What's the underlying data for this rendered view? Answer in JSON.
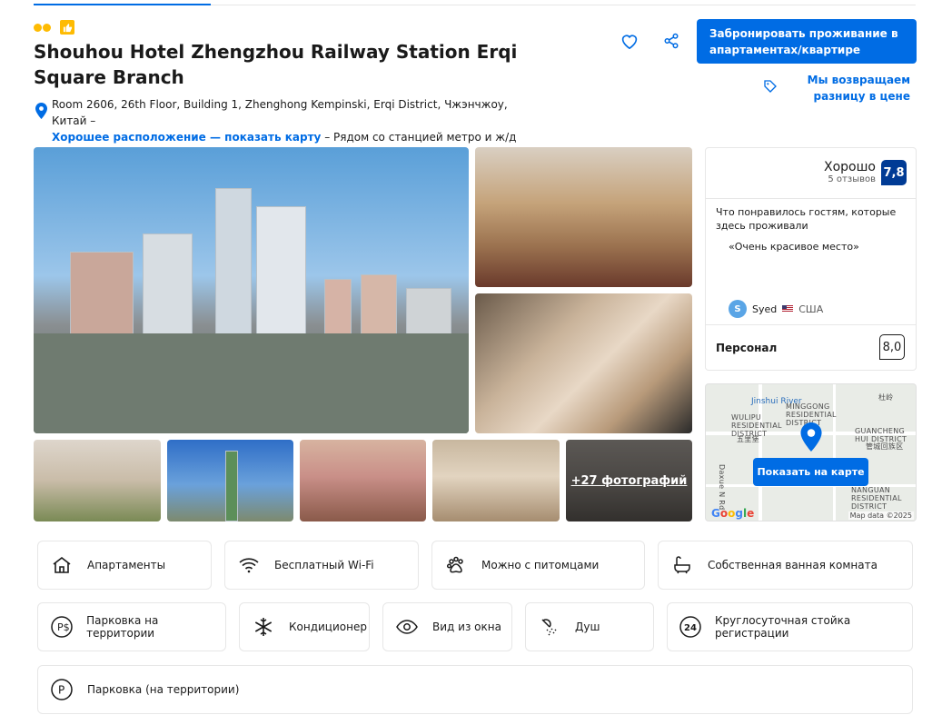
{
  "header": {
    "title": "Shouhou Hotel Zhengzhou Railway Station Erqi Square Branch",
    "address": "Room 2606, 26th Floor, Building 1, Zhenghong Kempinski, Erqi District, Чжэнчжоу, Китай –",
    "location_link": "Хорошее расположение — показать карту",
    "location_note": "– Рядом со станцией метро и ж/д",
    "book_button": "Забронировать проживание в апартаментах/квартире",
    "price_match": "Мы возвращаем разницу в цене",
    "icons": [
      "heart-icon",
      "share-icon",
      "price-tag-icon"
    ]
  },
  "gallery": {
    "more_photos": "+27 фотографий"
  },
  "reviews": {
    "rating_word": "Хорошо",
    "review_count": "5 отзывов",
    "score": "7,8",
    "liked_heading": "Что понравилось гостям, которые здесь проживали",
    "quote": "«Очень красивое место»",
    "author_initial": "S",
    "author_name": "Syed",
    "author_country": "США",
    "staff_label": "Персонал",
    "staff_score": "8,0"
  },
  "map": {
    "button": "Показать на карте",
    "river": "Jinshui River",
    "labels": {
      "wulipu": "WULIPU\nRESIDENTIAL\nDISTRICT",
      "wulipu_cn": "五里堡",
      "minggong": "MINGGONG\nRESIDENTIAL\nDISTRICT",
      "guancheng": "GUANCHENG\nHUI DISTRICT",
      "guancheng_cn": "管城回族区",
      "nanguan": "NANGUAN\nRESIDENTIAL\nDISTRICT",
      "daxue": "Daxue N Rd",
      "duling": "杜岭"
    },
    "google": "Google",
    "map_data": "Map data ©2025"
  },
  "facilities": [
    {
      "label": "Апартаменты",
      "icon": "apartment-icon"
    },
    {
      "label": "Бесплатный Wi-Fi",
      "icon": "wifi-icon"
    },
    {
      "label": "Можно с питомцами",
      "icon": "paw-icon"
    },
    {
      "label": "Собственная ванная комната",
      "icon": "bathtub-icon"
    },
    {
      "label": "Парковка на территории",
      "icon": "paid-parking-icon"
    },
    {
      "label": "Кондиционер",
      "icon": "snowflake-icon"
    },
    {
      "label": "Вид из окна",
      "icon": "eye-icon"
    },
    {
      "label": "Душ",
      "icon": "shower-icon"
    },
    {
      "label": "Круглосуточная стойка регистрации",
      "icon": "24h-icon"
    },
    {
      "label": "Парковка (на территории)",
      "icon": "parking-icon"
    }
  ],
  "colors": {
    "brand_blue": "#006ce4",
    "score_blue": "#003b95",
    "badge_yellow": "#febb02"
  }
}
